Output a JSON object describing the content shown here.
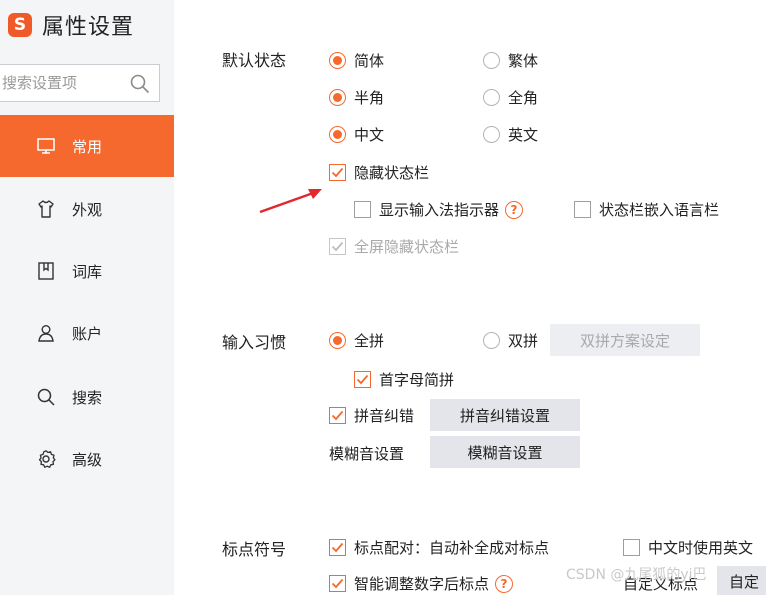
{
  "app": {
    "title": "属性设置",
    "logo_letter": "S"
  },
  "search": {
    "placeholder": "搜索设置项"
  },
  "sidebar": {
    "items": [
      {
        "label": "常用",
        "icon": "monitor-icon",
        "active": true
      },
      {
        "label": "外观",
        "icon": "shirt-icon"
      },
      {
        "label": "词库",
        "icon": "book-icon"
      },
      {
        "label": "账户",
        "icon": "user-icon"
      },
      {
        "label": "搜索",
        "icon": "search-icon"
      },
      {
        "label": "高级",
        "icon": "gear-icon"
      }
    ]
  },
  "default_state": {
    "label": "默认状态",
    "simplified": "简体",
    "traditional": "繁体",
    "half_width": "半角",
    "full_width": "全角",
    "chinese": "中文",
    "english": "英文",
    "hide_status_bar": "隐藏状态栏",
    "show_indicator": "显示输入法指示器",
    "embed_language_bar": "状态栏嵌入语言栏",
    "fullscreen_hide": "全屏隐藏状态栏"
  },
  "input_habit": {
    "label": "输入习惯",
    "full_pinyin": "全拼",
    "double_pinyin": "双拼",
    "double_scheme_button": "双拼方案设定",
    "initial_abbrev": "首字母简拼",
    "pinyin_correction": "拼音纠错",
    "pinyin_correction_button": "拼音纠错设置",
    "fuzzy_label": "模糊音设置",
    "fuzzy_button": "模糊音设置"
  },
  "punctuation": {
    "label": "标点符号",
    "pairing": "标点配对：自动补全成对标点",
    "chinese_use_english": "中文时使用英文",
    "smart_adjust": "智能调整数字后标点",
    "custom_label": "自定义标点",
    "custom_button": "自定"
  },
  "watermark": "CSDN @九尾狐的yi巴",
  "colors": {
    "accent": "#f5692e",
    "sidebar_bg": "#f4f5f7",
    "button_bg": "#e3e5ea",
    "arrow": "#e0282e"
  }
}
